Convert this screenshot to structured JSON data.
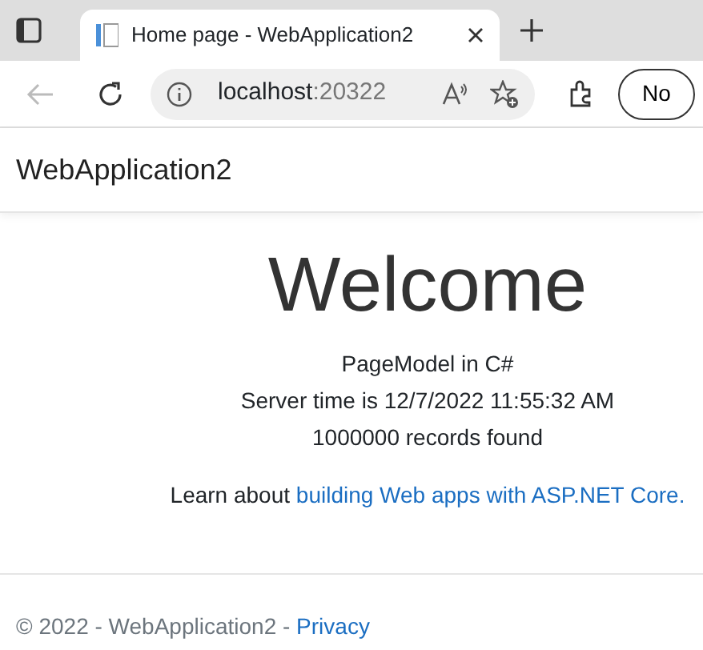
{
  "browser": {
    "tab": {
      "title": "Home page - WebApplication2",
      "selected": true
    },
    "address": {
      "host": "localhost",
      "port": ":20322"
    },
    "profile_button": "No"
  },
  "navbar": {
    "brand": "WebApplication2"
  },
  "main": {
    "heading": "Welcome",
    "lines": [
      "PageModel in C#",
      "Server time is 12/7/2022 11:55:32 AM",
      "1000000 records found"
    ],
    "learn": {
      "text": "Learn about",
      "link": "building Web apps with ASP.NET Core."
    }
  },
  "footer": {
    "text": "© 2022 - WebApplication2 -",
    "link": "Privacy"
  }
}
